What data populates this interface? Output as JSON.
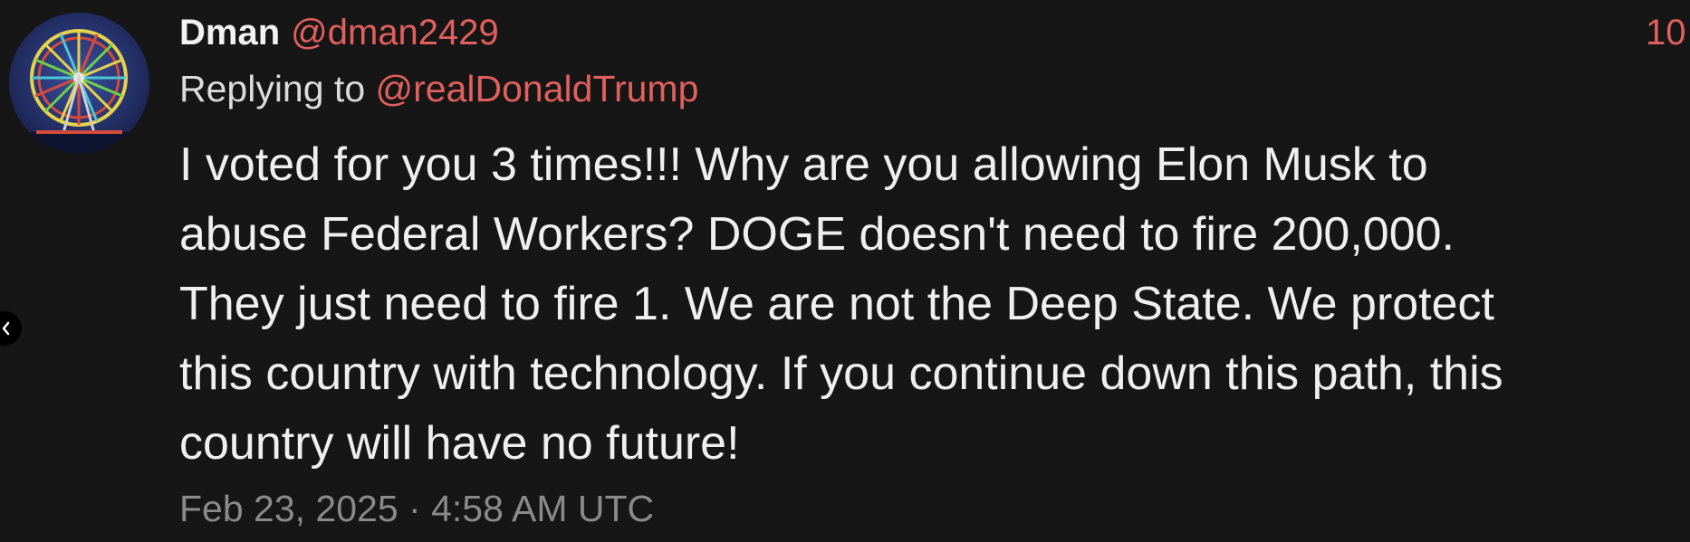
{
  "tweet": {
    "display_name": "Dman",
    "handle": "@dman2429",
    "count": "10",
    "replying_to_label": "Replying to",
    "replying_to_handle": "@realDonaldTrump",
    "body": "I voted for you 3 times!!! Why are you allowing Elon Musk to\nabuse Federal Workers? DOGE doesn't need to fire 200,000.\nThey just need to fire 1. We are not the Deep State. We protect\nthis country with technology. If you continue down this path, this\ncountry will have no future!",
    "timestamp": "Feb 23, 2025 · 4:58 AM UTC"
  },
  "icons": {
    "avatar": "ferris-wheel-avatar",
    "nav": "chevron-left-icon"
  },
  "colors": {
    "background": "#161616",
    "accent": "#e0605d",
    "text": "#efefef",
    "muted": "#8a8a8a"
  }
}
